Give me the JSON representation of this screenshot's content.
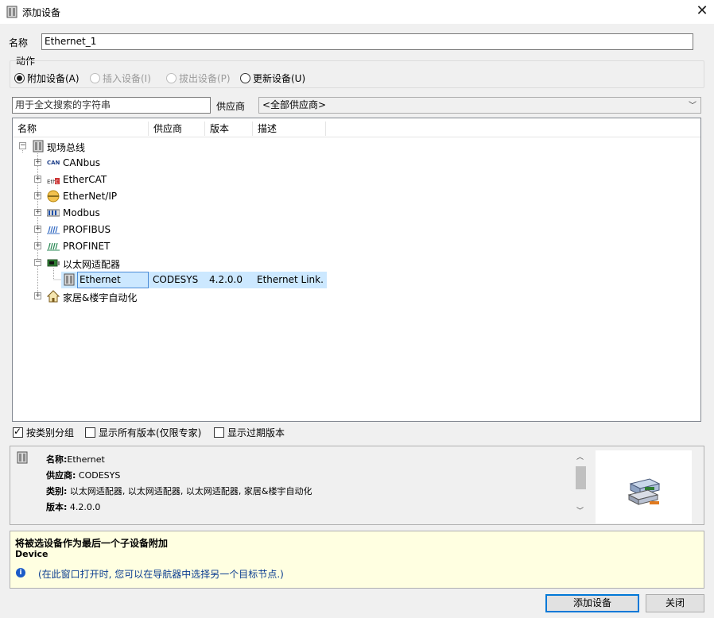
{
  "window": {
    "title": "添加设备",
    "close_icon": "close-icon"
  },
  "name_field": {
    "label": "名称",
    "value": "Ethernet_1"
  },
  "action": {
    "label": "动作",
    "options": [
      {
        "label": "附加设备(A)",
        "selected": true,
        "enabled": true
      },
      {
        "label": "插入设备(I)",
        "selected": false,
        "enabled": false
      },
      {
        "label": "拔出设备(P)",
        "selected": false,
        "enabled": false
      },
      {
        "label": "更新设备(U)",
        "selected": false,
        "enabled": true
      }
    ]
  },
  "search": {
    "placeholder": "用于全文搜索的字符串",
    "vendor_label": "供应商",
    "vendor_value": "<全部供应商>"
  },
  "tree": {
    "columns": [
      "名称",
      "供应商",
      "版本",
      "描述"
    ],
    "root": {
      "label": "现场总线",
      "expanded": true
    },
    "items": [
      {
        "label": "CANbus",
        "icon": "can-icon"
      },
      {
        "label": "EtherCAT",
        "icon": "ethercat-icon"
      },
      {
        "label": "EtherNet/IP",
        "icon": "ethernetip-icon"
      },
      {
        "label": "Modbus",
        "icon": "modbus-icon"
      },
      {
        "label": "PROFIBUS",
        "icon": "profibus-icon"
      },
      {
        "label": "PROFINET",
        "icon": "profinet-icon"
      },
      {
        "label": "以太网适配器",
        "icon": "ethernet-adapter-icon",
        "expanded": true
      }
    ],
    "selected_child": {
      "name": "Ethernet",
      "vendor": "CODESYS",
      "version": "4.2.0.0",
      "description": "Ethernet Link."
    },
    "last_item": {
      "label": "家居&楼宇自动化",
      "icon": "home-icon"
    }
  },
  "options": [
    {
      "label": "按类别分组",
      "checked": true
    },
    {
      "label": "显示所有版本(仅限专家)",
      "checked": false
    },
    {
      "label": "显示过期版本",
      "checked": false
    }
  ],
  "details": {
    "name_label": "名称:",
    "name_value": "Ethernet",
    "vendor_label": "供应商:",
    "vendor_value": "CODESYS",
    "category_label": "类别:",
    "category_value": "以太网适配器, 以太网适配器, 以太网适配器, 家居&楼宇自动化",
    "version_label": "版本:",
    "version_value": "4.2.0.0"
  },
  "message": {
    "heading": "将被选设备作为最后一个子设备附加",
    "target": "Device",
    "hint": "(在此窗口打开时, 您可以在导航器中选择另一个目标节点.)"
  },
  "buttons": {
    "add": "添加设备",
    "close": "关闭"
  }
}
